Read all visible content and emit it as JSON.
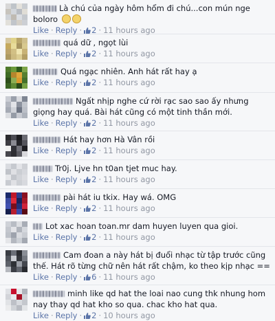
{
  "actions": {
    "like": "Like",
    "reply": "Reply",
    "separator": "·"
  },
  "comments": [
    {
      "text": "Là chú của ngày hôm hổm đi chú...con mún nge boloro",
      "emoji_count": 2,
      "likes": "2",
      "time": "11 hours ago",
      "avatar": [
        "#d8d8d8",
        "#bfc4c9",
        "#e4e2dc",
        "#c9cdd2",
        "#c7c4bd",
        "#d2d6db",
        "#b8bcc2",
        "#e0ddd6",
        "#cfd3d8",
        "#bfbab2",
        "#dadde2",
        "#c4c8cd",
        "#e2e0da",
        "#c1c5ca",
        "#d4d0c9",
        "#cccfd4"
      ]
    },
    {
      "text": "quá dữ , ngọt lùi",
      "likes": "2",
      "time": "11 hours ago",
      "avatar": [
        "#d6c8a0",
        "#e0d38a",
        "#b9a66a",
        "#cfc08d",
        "#c5a95e",
        "#e8dc9a",
        "#a79560",
        "#d8c98f",
        "#bca46b",
        "#d2c085",
        "#f0e6b2",
        "#c8b276",
        "#ad9a63",
        "#cdbb81",
        "#dccd93",
        "#b49f66"
      ]
    },
    {
      "text": "Quá ngạc nhiên. Anh hát rất hay ạ",
      "likes": "2",
      "time": "11 hours ago",
      "avatar": [
        "#4f7a2c",
        "#6b9a3a",
        "#2f5a1c",
        "#7ea548",
        "#3e6b24",
        "#b5862d",
        "#e0a63a",
        "#567f30",
        "#2e4f1a",
        "#8cad52",
        "#d89a2f",
        "#44702a",
        "#3a6322",
        "#5f8a34",
        "#2a4a18",
        "#76a043"
      ]
    },
    {
      "text": "Ngất nhịp nghe cứ rời rạc sao sao ấy nhưng giọng hay quá. Bài hát cũng có một tinh thần mới.",
      "likes": "2",
      "time": "11 hours ago",
      "avatar": [
        "#c9ccd3",
        "#9aa0ab",
        "#d7d9de",
        "#7e8592",
        "#b3b7c0",
        "#e1e3e7",
        "#8c929e",
        "#c2c6cd",
        "#a5aab4",
        "#d0d3d9",
        "#6f7684",
        "#bcc0c8",
        "#dadce0",
        "#959ba6",
        "#c8cbd2",
        "#aeb3bc"
      ]
    },
    {
      "text": "Hát hay hơn Hà Vân rồi",
      "likes": "2",
      "time": "11 hours ago",
      "avatar": [
        "#2a2a2e",
        "#4a4a52",
        "#1c1c20",
        "#6b6b73",
        "#3c3c42",
        "#8a8a92",
        "#25252a",
        "#55555c",
        "#f0f0f0",
        "#303036",
        "#707078",
        "#1e1e22",
        "#46464d",
        "#2e2e33",
        "#5c5c63",
        "#d8d8dc"
      ]
    },
    {
      "text": "Tr0j. Ljve hn t0an tjet muc hay.",
      "likes": "2",
      "time": "11 hours ago",
      "avatar": [
        "#d9dbe0",
        "#c6c9cf",
        "#e3e4e8",
        "#cfd1d6",
        "#c0c3c9",
        "#dfe0e4",
        "#cbced3",
        "#d5d7dc",
        "#e6e7ea",
        "#c3c6cc",
        "#d2d4d9",
        "#dcdde1",
        "#c8cbd1",
        "#e0e1e5",
        "#cdd0d5",
        "#d7d9de"
      ]
    },
    {
      "text": "pài hát iu tkix. Hay wá. OMG",
      "likes": "2",
      "time": "11 hours ago",
      "avatar": [
        "#1a2a6b",
        "#c0182a",
        "#2b3b8c",
        "#8a1020",
        "#3a4aa0",
        "#e02a3a",
        "#18225a",
        "#a51828",
        "#4050b0",
        "#7a0e1c",
        "#22307a",
        "#d0243a",
        "#15204e",
        "#b81e30",
        "#3848a8",
        "#5a0a14"
      ]
    },
    {
      "text": "Lot xac hoan toan.mr dam huyen luyen qua gioi.",
      "likes": "2",
      "time": "11 hours ago",
      "avatar": [
        "#cfd2d8",
        "#b8bcc4",
        "#dcdee2",
        "#a8adb6",
        "#c4c7ce",
        "#e2e3e7",
        "#b0b4bc",
        "#d5d8dd",
        "#bec2c9",
        "#9ea3ad",
        "#d9dbe0",
        "#c9ccd2",
        "#e5e6e9",
        "#b4b8c0",
        "#ccd0d6",
        "#a3a8b1"
      ]
    },
    {
      "text": "Cam đoan a này hát bị đuổi nhạc từ tập trước cũng thế. Hát rõ từng chữ nên hát rất chậm, ko theo kịp nhạc ==",
      "likes": "6",
      "time": "11 hours ago",
      "avatar": [
        "#3a3d44",
        "#6b6f78",
        "#2a2c31",
        "#8a8e96",
        "#50545c",
        "#c9ccd2",
        "#34373d",
        "#747880",
        "#5e626a",
        "#2e3136",
        "#9a9ea6",
        "#44474e",
        "#b5b8be",
        "#3c3f46",
        "#62666e",
        "#282a2f"
      ]
    },
    {
      "text": "minh like qd hat the loai nao cung thk nhung hom nay thay qd hat kho so qua. chac kho hat qua.",
      "likes": "2",
      "time": "10 hours ago",
      "avatar": [
        "#dfe1e5",
        "#c8102e",
        "#e6e7ea",
        "#b0b4bc",
        "#d2d4d9",
        "#e8eaed",
        "#a61226",
        "#cfd2d7",
        "#e1e3e6",
        "#bdc0c7",
        "#d8dadf",
        "#c4c7cd",
        "#ebeced",
        "#d0d3d8",
        "#b8bbc2",
        "#e3e5e8"
      ]
    }
  ]
}
